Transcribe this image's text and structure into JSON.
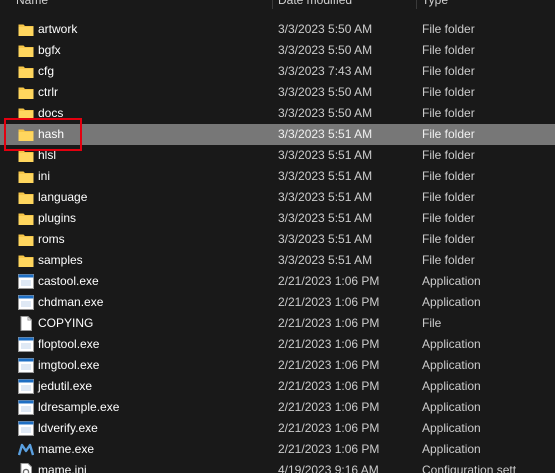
{
  "header": {
    "name": "Name",
    "date_modified": "Date modified",
    "type": "Type"
  },
  "files": [
    {
      "name": "artwork",
      "date": "3/3/2023 5:50 AM",
      "type": "File folder",
      "icon": "folder-icon"
    },
    {
      "name": "bgfx",
      "date": "3/3/2023 5:50 AM",
      "type": "File folder",
      "icon": "folder-icon"
    },
    {
      "name": "cfg",
      "date": "3/3/2023 7:43 AM",
      "type": "File folder",
      "icon": "folder-icon"
    },
    {
      "name": "ctrlr",
      "date": "3/3/2023 5:50 AM",
      "type": "File folder",
      "icon": "folder-icon"
    },
    {
      "name": "docs",
      "date": "3/3/2023 5:50 AM",
      "type": "File folder",
      "icon": "folder-icon"
    },
    {
      "name": "hash",
      "date": "3/3/2023 5:51 AM",
      "type": "File folder",
      "icon": "folder-icon",
      "selected": true
    },
    {
      "name": "hlsl",
      "date": "3/3/2023 5:51 AM",
      "type": "File folder",
      "icon": "folder-icon"
    },
    {
      "name": "ini",
      "date": "3/3/2023 5:51 AM",
      "type": "File folder",
      "icon": "folder-icon"
    },
    {
      "name": "language",
      "date": "3/3/2023 5:51 AM",
      "type": "File folder",
      "icon": "folder-icon"
    },
    {
      "name": "plugins",
      "date": "3/3/2023 5:51 AM",
      "type": "File folder",
      "icon": "folder-icon"
    },
    {
      "name": "roms",
      "date": "3/3/2023 5:51 AM",
      "type": "File folder",
      "icon": "folder-icon"
    },
    {
      "name": "samples",
      "date": "3/3/2023 5:51 AM",
      "type": "File folder",
      "icon": "folder-icon"
    },
    {
      "name": "castool.exe",
      "date": "2/21/2023 1:06 PM",
      "type": "Application",
      "icon": "application-icon"
    },
    {
      "name": "chdman.exe",
      "date": "2/21/2023 1:06 PM",
      "type": "Application",
      "icon": "application-icon"
    },
    {
      "name": "COPYING",
      "date": "2/21/2023 1:06 PM",
      "type": "File",
      "icon": "file-icon"
    },
    {
      "name": "floptool.exe",
      "date": "2/21/2023 1:06 PM",
      "type": "Application",
      "icon": "application-icon"
    },
    {
      "name": "imgtool.exe",
      "date": "2/21/2023 1:06 PM",
      "type": "Application",
      "icon": "application-icon"
    },
    {
      "name": "jedutil.exe",
      "date": "2/21/2023 1:06 PM",
      "type": "Application",
      "icon": "application-icon"
    },
    {
      "name": "ldresample.exe",
      "date": "2/21/2023 1:06 PM",
      "type": "Application",
      "icon": "application-icon"
    },
    {
      "name": "ldverify.exe",
      "date": "2/21/2023 1:06 PM",
      "type": "Application",
      "icon": "application-icon"
    },
    {
      "name": "mame.exe",
      "date": "2/21/2023 1:06 PM",
      "type": "Application",
      "icon": "mame-icon"
    },
    {
      "name": "mame.ini",
      "date": "4/19/2023 9:16 AM",
      "type": "Configuration sett",
      "icon": "settings-file-icon"
    }
  ],
  "colors": {
    "background": "#191919",
    "selected_row": "#777777",
    "highlight_box": "#e3000f",
    "folder": "#f6c648",
    "app_icon_blue": "#1e6fc4"
  }
}
